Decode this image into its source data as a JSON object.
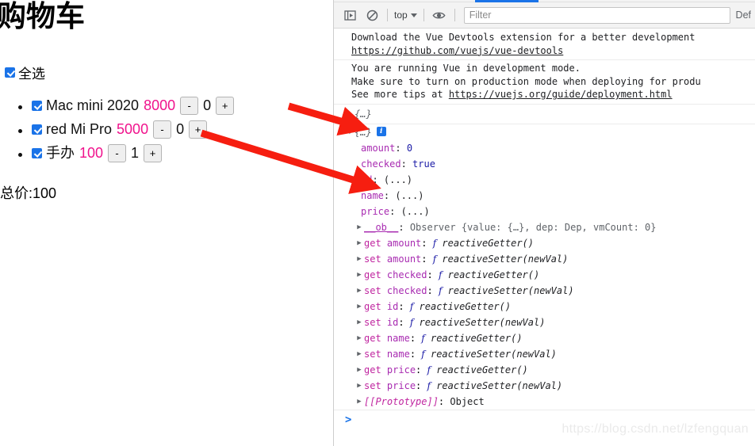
{
  "app": {
    "title": "购物车",
    "select_all_label": "全选",
    "items": [
      {
        "checked": true,
        "name": "Mac mini 2020",
        "price": "8000",
        "minus": "-",
        "qty": "0",
        "plus": "+"
      },
      {
        "checked": true,
        "name": "red Mi Pro",
        "price": "5000",
        "minus": "-",
        "qty": "0",
        "plus": "+"
      },
      {
        "checked": true,
        "name": "手办",
        "price": "100",
        "minus": "-",
        "qty": "1",
        "plus": "+"
      }
    ],
    "total_label": "总价:100"
  },
  "devtools": {
    "toolbar": {
      "sidebar_icon": "sidebar-toggle-icon",
      "clear_icon": "clear-console-icon",
      "context": "top",
      "eye_icon": "live-expression-icon",
      "filter_placeholder": "Filter",
      "levels_label": "Def"
    },
    "messages": [
      {
        "lines": [
          "Download the Vue Devtools extension for a better development",
          "https://github.com/vuejs/vue-devtools"
        ]
      },
      {
        "lines": [
          "You are running Vue in development mode.",
          "Make sure to turn on production mode when deploying for produ",
          "See more tips at https://vuejs.org/guide/deployment.html"
        ]
      }
    ],
    "collapsed_object": {
      "triangle": "▶",
      "label": "{…}"
    },
    "expanded_object": {
      "triangle": "▼",
      "label": "{…}",
      "info_badge": "i"
    },
    "properties": [
      {
        "key": "amount",
        "sep": ": ",
        "value": "0",
        "value_type": "number"
      },
      {
        "key": "checked",
        "sep": ": ",
        "value": "true",
        "value_type": "boolean"
      },
      {
        "key": "id",
        "sep": ": ",
        "value": "(...)",
        "value_type": "dots"
      },
      {
        "key": "name",
        "sep": ": ",
        "value": "(...)",
        "value_type": "dots"
      },
      {
        "key": "price",
        "sep": ": ",
        "value": "(...)",
        "value_type": "dots"
      }
    ],
    "observer_row": {
      "triangle": "▶",
      "key": "__ob__",
      "sep": ": ",
      "value": "Observer {value: {…}, dep: Dep, vmCount: 0}"
    },
    "accessors": [
      {
        "triangle": "▶",
        "kind": "get",
        "key": "amount",
        "sep": ": ",
        "f": "f",
        "fn": "reactiveGetter()"
      },
      {
        "triangle": "▶",
        "kind": "set",
        "key": "amount",
        "sep": ": ",
        "f": "f",
        "fn": "reactiveSetter(newVal)"
      },
      {
        "triangle": "▶",
        "kind": "get",
        "key": "checked",
        "sep": ": ",
        "f": "f",
        "fn": "reactiveGetter()"
      },
      {
        "triangle": "▶",
        "kind": "set",
        "key": "checked",
        "sep": ": ",
        "f": "f",
        "fn": "reactiveSetter(newVal)"
      },
      {
        "triangle": "▶",
        "kind": "get",
        "key": "id",
        "sep": ": ",
        "f": "f",
        "fn": "reactiveGetter()"
      },
      {
        "triangle": "▶",
        "kind": "set",
        "key": "id",
        "sep": ": ",
        "f": "f",
        "fn": "reactiveSetter(newVal)"
      },
      {
        "triangle": "▶",
        "kind": "get",
        "key": "name",
        "sep": ": ",
        "f": "f",
        "fn": "reactiveGetter()"
      },
      {
        "triangle": "▶",
        "kind": "set",
        "key": "name",
        "sep": ": ",
        "f": "f",
        "fn": "reactiveSetter(newVal)"
      },
      {
        "triangle": "▶",
        "kind": "get",
        "key": "price",
        "sep": ": ",
        "f": "f",
        "fn": "reactiveGetter()"
      },
      {
        "triangle": "▶",
        "kind": "set",
        "key": "price",
        "sep": ": ",
        "f": "f",
        "fn": "reactiveSetter(newVal)"
      }
    ],
    "prototype_row": {
      "triangle": "▶",
      "key": "[[Prototype]]",
      "sep": ": ",
      "value": "Object"
    },
    "prompt": ">"
  },
  "watermark": "https://blog.csdn.net/lzfengquan",
  "colors": {
    "accent_blue": "#1a73e8",
    "price_pink": "#f0128c",
    "arrow_red": "#f61e10",
    "key_purple": "#a82bb1",
    "value_blue": "#1a1aa6"
  }
}
